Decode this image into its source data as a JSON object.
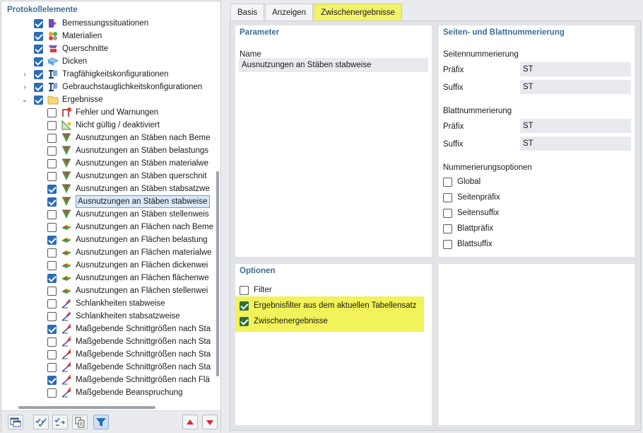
{
  "left_panel": {
    "title": "Protokollelemente",
    "items": [
      {
        "label": "Bemessungssituationen",
        "checked": true,
        "icon": "design-situations-icon"
      },
      {
        "label": "Materialien",
        "checked": true,
        "icon": "materials-icon"
      },
      {
        "label": "Querschnitte",
        "checked": true,
        "icon": "cross-sections-icon"
      },
      {
        "label": "Dicken",
        "checked": true,
        "icon": "thickness-icon"
      },
      {
        "label": "Tragfähigkeitskonfigurationen",
        "checked": true,
        "icon": "uls-config-icon",
        "expander": "collapsed"
      },
      {
        "label": "Gebrauchstauglichkeitskonfigurationen",
        "checked": true,
        "icon": "sls-config-icon",
        "expander": "collapsed"
      },
      {
        "label": "Ergebnisse",
        "checked": true,
        "icon": "folder-icon",
        "expander": "expanded"
      },
      {
        "label": "Fehler und Warnungen",
        "checked": false,
        "icon": "error-warning-icon"
      },
      {
        "label": "Nicht gültig / deaktiviert",
        "checked": false,
        "icon": "invalid-icon"
      },
      {
        "label": "Ausnutzungen an Stäben nach Beme",
        "checked": false,
        "icon": "member-ratio-icon"
      },
      {
        "label": "Ausnutzungen an Stäben belastungs",
        "checked": false,
        "icon": "member-ratio-icon"
      },
      {
        "label": "Ausnutzungen an Stäben materialwe",
        "checked": false,
        "icon": "member-ratio-icon"
      },
      {
        "label": "Ausnutzungen an Stäben querschnit",
        "checked": false,
        "icon": "member-ratio-icon"
      },
      {
        "label": "Ausnutzungen an Stäben stabsatzwe",
        "checked": true,
        "icon": "member-ratio-icon"
      },
      {
        "label": "Ausnutzungen an Stäben stabweise",
        "checked": true,
        "icon": "member-ratio-icon",
        "selected": true
      },
      {
        "label": "Ausnutzungen an Stäben stellenweis",
        "checked": false,
        "icon": "member-ratio-icon"
      },
      {
        "label": "Ausnutzungen an Flächen nach Beme",
        "checked": false,
        "icon": "surface-ratio-icon"
      },
      {
        "label": "Ausnutzungen an Flächen belastung",
        "checked": true,
        "icon": "surface-ratio-icon"
      },
      {
        "label": "Ausnutzungen an Flächen materialwe",
        "checked": false,
        "icon": "surface-ratio-icon"
      },
      {
        "label": "Ausnutzungen an Flächen dickenwei",
        "checked": false,
        "icon": "surface-ratio-icon"
      },
      {
        "label": "Ausnutzungen an Flächen flächenwe",
        "checked": true,
        "icon": "surface-ratio-icon"
      },
      {
        "label": "Ausnutzungen an Flächen stellenwei",
        "checked": false,
        "icon": "surface-ratio-icon"
      },
      {
        "label": "Schlankheiten stabweise",
        "checked": false,
        "icon": "slenderness-icon"
      },
      {
        "label": "Schlankheiten stabsatzweise",
        "checked": false,
        "icon": "slenderness-icon"
      },
      {
        "label": "Maßgebende Schnittgrößen nach Sta",
        "checked": true,
        "icon": "internal-forces-icon"
      },
      {
        "label": "Maßgebende Schnittgrößen nach Sta",
        "checked": false,
        "icon": "internal-forces-icon"
      },
      {
        "label": "Maßgebende Schnittgrößen nach Sta",
        "checked": false,
        "icon": "internal-forces-icon"
      },
      {
        "label": "Maßgebende Schnittgrößen nach Sta",
        "checked": false,
        "icon": "internal-forces-icon"
      },
      {
        "label": "Maßgebende Schnittgrößen nach Flä",
        "checked": true,
        "icon": "internal-forces-icon"
      },
      {
        "label": "Maßgebende Beanspruchung",
        "checked": false,
        "icon": "internal-forces-icon"
      }
    ],
    "toolbar": [
      {
        "icon": "window-icon"
      },
      {
        "icon": "check-all-icon"
      },
      {
        "icon": "toggle-check-icon"
      },
      {
        "icon": "copy-settings-icon"
      },
      {
        "icon": "filter-icon",
        "active": true
      },
      {
        "icon": "move-up-icon"
      },
      {
        "icon": "move-down-icon"
      }
    ]
  },
  "tabs": [
    {
      "label": "Basis",
      "active": false
    },
    {
      "label": "Anzeigen",
      "active": false
    },
    {
      "label": "Zwischenergebnisse",
      "active": true
    }
  ],
  "parameter": {
    "title": "Parameter",
    "name_label": "Name",
    "name_value": "Ausnutzungen an Stäben stabweise"
  },
  "numbering": {
    "title": "Seiten- und Blattnummerierung",
    "page_heading": "Seitennummerierung",
    "page_prefix_label": "Präfix",
    "page_prefix_value": "ST",
    "page_suffix_label": "Suffix",
    "page_suffix_value": "ST",
    "sheet_heading": "Blattnummerierung",
    "sheet_prefix_label": "Präfix",
    "sheet_prefix_value": "ST",
    "sheet_suffix_label": "Suffix",
    "sheet_suffix_value": "ST",
    "options_heading": "Nummerierungsoptionen",
    "options": [
      {
        "label": "Global",
        "checked": false
      },
      {
        "label": "Seitenpräfix",
        "checked": false
      },
      {
        "label": "Seitensuffix",
        "checked": false
      },
      {
        "label": "Blattpräfix",
        "checked": false
      },
      {
        "label": "Blattsuffix",
        "checked": false
      }
    ]
  },
  "optionen": {
    "title": "Optionen",
    "items": [
      {
        "label": "Filter",
        "checked": false
      },
      {
        "label": "Ergebnisfilter aus dem aktuellen Tabellensatz",
        "checked": true
      },
      {
        "label": "Zwischenergebnisse",
        "checked": true
      }
    ]
  },
  "colors": {
    "accent_title": "#3b6e98",
    "highlight": "#f2f25a",
    "check_blue": "#2b6cb5",
    "check_green": "#2c6e3c"
  }
}
